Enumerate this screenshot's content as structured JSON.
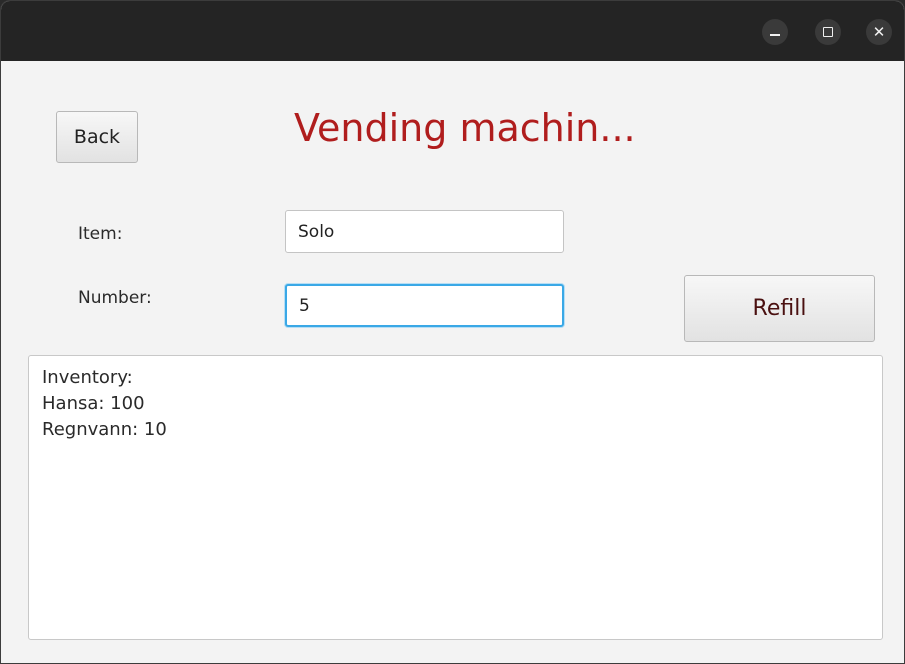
{
  "window": {
    "controls": {
      "minimize_icon": "minimize-icon",
      "maximize_icon": "maximize-icon",
      "close_icon": "close-icon",
      "close_glyph": "✕"
    }
  },
  "header": {
    "back_label": "Back",
    "title": "Vending machin..."
  },
  "form": {
    "item_label": "Item:",
    "item_value": "Solo",
    "number_label": "Number:",
    "number_value": "5",
    "refill_label": "Refill"
  },
  "inventory": {
    "lines": [
      "Inventory:",
      "Hansa: 100",
      "Regnvann: 10"
    ]
  },
  "colors": {
    "title": "#b01d1d",
    "focus_border": "#3aa8e6",
    "titlebar": "#242424",
    "background": "#f3f3f3"
  }
}
